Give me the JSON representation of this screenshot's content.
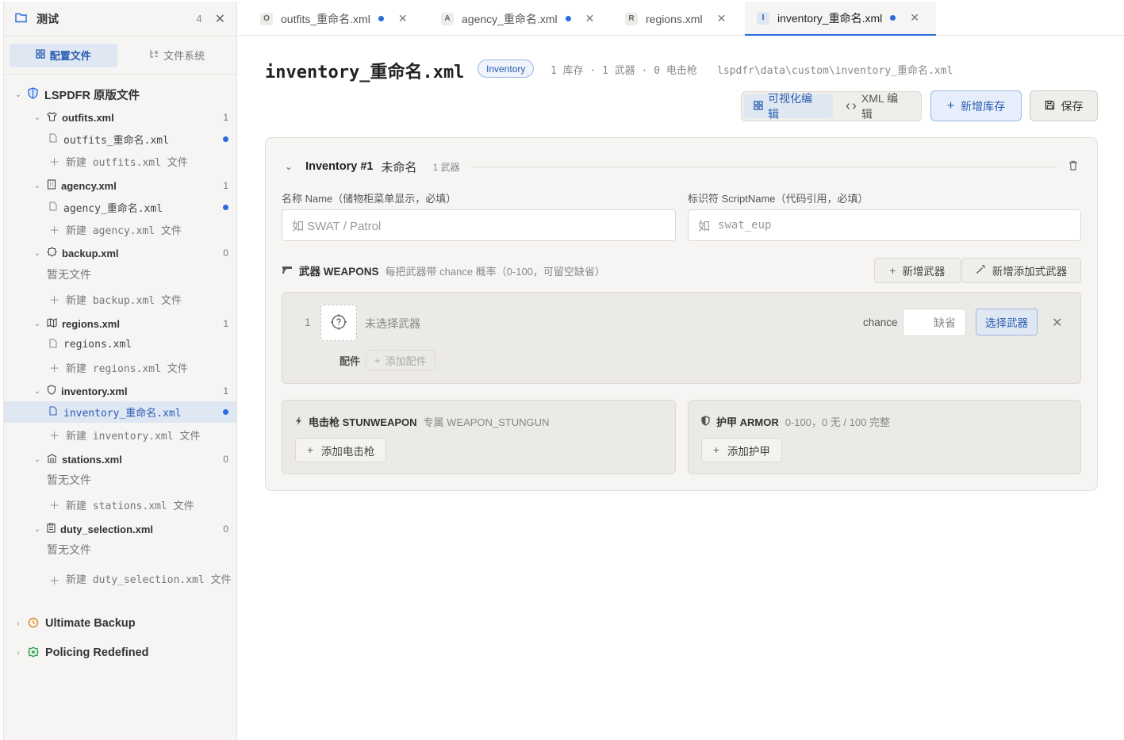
{
  "sidebar": {
    "workspace_title": "测试",
    "workspace_count": "4",
    "tabs": [
      {
        "label": "配置文件",
        "active": true
      },
      {
        "label": "文件系统",
        "active": false
      }
    ],
    "root": "LSPDFR 原版文件",
    "groups": [
      {
        "name": "outfits.xml",
        "count": "1",
        "files": [
          "outfits_重命名.xml"
        ],
        "new": "新建 outfits.xml 文件"
      },
      {
        "name": "agency.xml",
        "count": "1",
        "files": [
          "agency_重命名.xml"
        ],
        "new": "新建 agency.xml 文件"
      },
      {
        "name": "backup.xml",
        "count": "0",
        "empty": "暂无文件",
        "new": "新建 backup.xml 文件"
      },
      {
        "name": "regions.xml",
        "count": "1",
        "files": [
          "regions.xml"
        ],
        "new": "新建 regions.xml 文件"
      },
      {
        "name": "inventory.xml",
        "count": "1",
        "files": [
          "inventory_重命名.xml"
        ],
        "new": "新建 inventory.xml 文件"
      },
      {
        "name": "stations.xml",
        "count": "0",
        "empty": "暂无文件",
        "new": "新建 stations.xml 文件"
      },
      {
        "name": "duty_selection.xml",
        "count": "0",
        "empty": "暂无文件",
        "new": "新建 duty_selection.xml 文件"
      }
    ],
    "other_roots": [
      "Ultimate Backup",
      "Policing Redefined"
    ]
  },
  "tabs": [
    {
      "badge": "O",
      "label": "outfits_重命名.xml",
      "modified": true
    },
    {
      "badge": "A",
      "label": "agency_重命名.xml",
      "modified": true
    },
    {
      "badge": "R",
      "label": "regions.xml",
      "modified": false
    },
    {
      "badge": "I",
      "label": "inventory_重命名.xml",
      "modified": true,
      "active": true
    }
  ],
  "header": {
    "title": "inventory_重命名.xml",
    "type_pill": "Inventory",
    "stats": "1 库存 · 1 武器 · 0 电击枪",
    "path": "lspdfr\\data\\custom\\inventory_重命名.xml"
  },
  "toolbar": {
    "visual_edit": "可视化编辑",
    "xml_edit": "XML 编辑",
    "add_inventory": "新增库存",
    "save": "保存"
  },
  "inventory": {
    "title": "Inventory #1",
    "name": "未命名",
    "weapon_count": "1 武器",
    "name_label": "名称 Name（储物柜菜单显示，必填）",
    "name_placeholder": "如 SWAT / Patrol",
    "script_label": "标识符 ScriptName（代码引用，必填）",
    "script_prefix": "如",
    "script_placeholder": "swat_eup",
    "weapons_title": "武器 WEAPONS",
    "weapons_hint": "每把武器带 chance 概率（0-100，可留空缺省）",
    "add_weapon": "新增武器",
    "add_weapon_wizard": "新增添加式武器",
    "weapon": {
      "index": "1",
      "name": "未选择武器",
      "chance_label": "chance",
      "chance_placeholder": "缺省",
      "pick": "选择武器",
      "accessories_label": "配件",
      "add_accessory": "添加配件"
    },
    "stun": {
      "title": "电击枪 STUNWEAPON",
      "hint": "专属 WEAPON_STUNGUN",
      "button": "添加电击枪"
    },
    "armor": {
      "title": "护甲 ARMOR",
      "hint": "0-100，0 无 / 100 完整",
      "button": "添加护甲"
    }
  },
  "colors": {
    "accent": "#2b6be0",
    "accent_bg": "#dfe7f3",
    "panel": "#f6f5f3"
  }
}
